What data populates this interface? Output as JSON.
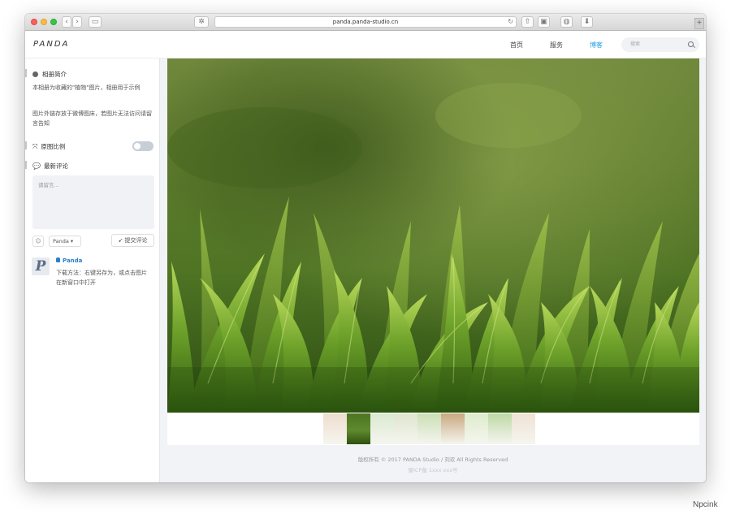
{
  "browser": {
    "url": "panda.panda-studio.cn"
  },
  "site": {
    "logo": "PANDA",
    "nav": [
      {
        "label": "首页"
      },
      {
        "label": "服务"
      },
      {
        "label": "博客"
      }
    ],
    "active_nav": "博客",
    "search_placeholder": "搜索"
  },
  "sidebar": {
    "intro_heading": "相册简介",
    "intro_text_1": "本相册为收藏的\"植物\"图片，相册用于示例",
    "intro_text_2": "图片外链存放于微博图床，若图片无法访问请留言告知",
    "ratio_heading": "原图比例",
    "ratio_toggle_on": false,
    "comments_heading": "最新评论",
    "comment_placeholder": "请留言...",
    "emoji_glyph": "☺",
    "user_select": "Panda ▾",
    "submit_label": "提交评论",
    "comment": {
      "avatar_letter": "P",
      "user": "Panda",
      "text": "下载方法：右键另存为，或点击图片在新窗口中打开"
    }
  },
  "main": {
    "footer_line_1": "版权所有 © 2017 PANDA Studio / 刘欢 All Rights Reserved",
    "footer_line_2": "蜀ICP备 1xxx xxx号",
    "thumbnails": [
      {
        "color": "#e9d2be"
      },
      {
        "color": "#5f8a2e"
      },
      {
        "color": "#cde3c2"
      },
      {
        "color": "#d5dcc0"
      },
      {
        "color": "#b9d49c"
      },
      {
        "color": "#b78d55"
      },
      {
        "color": "#d3e5bb"
      },
      {
        "color": "#a8cc88"
      },
      {
        "color": "#ead8c6"
      }
    ],
    "active_thumbnail_index": 1
  },
  "watermark": "Npcink"
}
